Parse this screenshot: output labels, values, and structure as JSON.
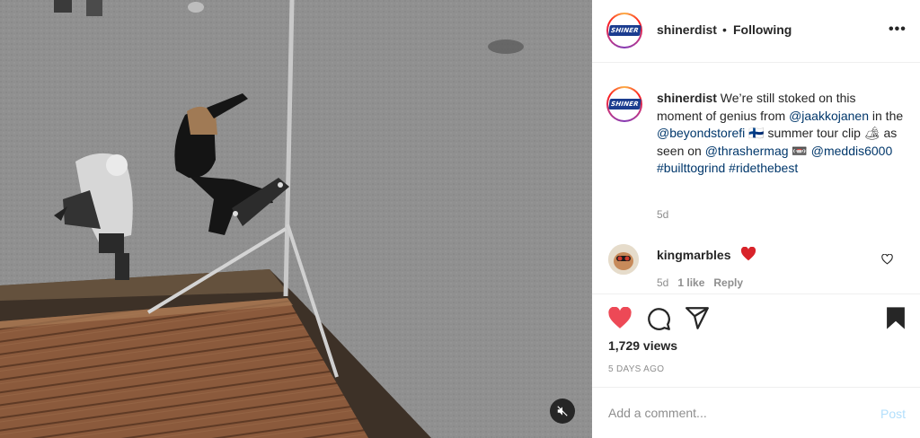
{
  "post": {
    "username": "shinerdist",
    "avatar_text": "SHINER",
    "follow_status": "Following",
    "more_label": "•••"
  },
  "caption": {
    "username": "shinerdist",
    "text_1": " We’re still stoked on this moment of genius from ",
    "mention_1": "@jaakkojanen",
    "text_2": " in the ",
    "mention_2": "@beyondstorefi",
    "text_3": " 🇫🇮 summer tour clip 🏕 as seen on ",
    "mention_3": "@thrashermag",
    "text_4": " 📼 ",
    "mention_4": "@meddis6000",
    "hashtag_1": "#builttogrind",
    "hashtag_2": "#ridethebest",
    "time": "5d"
  },
  "comments": [
    {
      "username": "kingmarbles",
      "emoji": "heart",
      "time": "5d",
      "likes": "1 like",
      "reply_label": "Reply"
    }
  ],
  "stats": {
    "views": "1,729 views",
    "posted": "5 DAYS AGO"
  },
  "composer": {
    "placeholder": "Add a comment...",
    "post_label": "Post"
  },
  "colors": {
    "link": "#00376b",
    "like_red": "#ed4956",
    "muted": "#8e8e8e",
    "post_disabled": "#b2dffc"
  },
  "icons": {
    "mute": "speaker-muted-icon",
    "like": "heart-filled-icon",
    "comment": "comment-bubble-icon",
    "share": "paper-plane-icon",
    "save": "bookmark-filled-icon",
    "more": "ellipsis-icon"
  }
}
